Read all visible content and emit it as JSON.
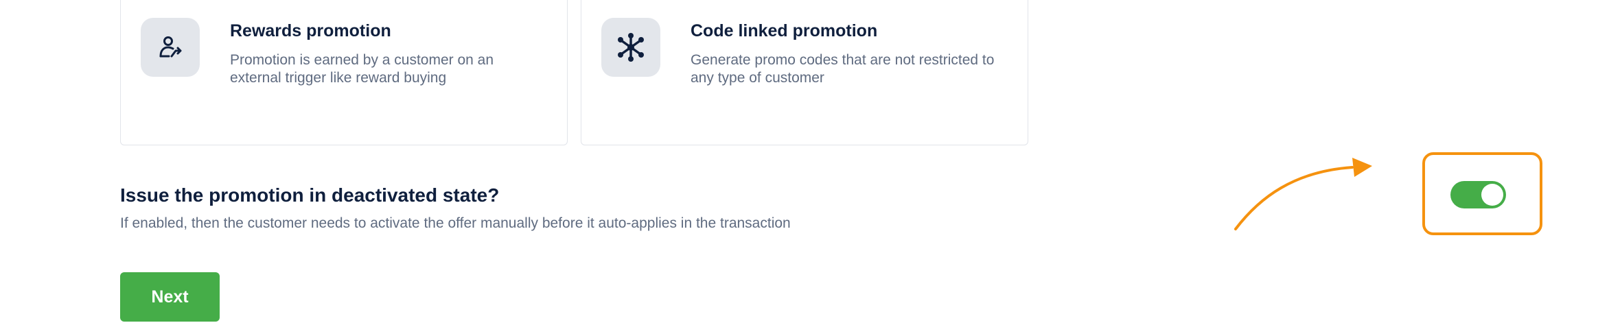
{
  "promotion_types": [
    {
      "title": "Rewards promotion",
      "description": "Promotion is earned by a customer on an external trigger like reward buying",
      "icon": "user-transfer-icon"
    },
    {
      "title": "Code linked promotion",
      "description": "Generate promo codes that are not restricted to any type of customer",
      "icon": "network-nodes-icon"
    }
  ],
  "deactivated_setting": {
    "title": "Issue the promotion in deactivated state?",
    "description": "If enabled, then the customer needs to activate the offer manually before it auto-applies in the transaction",
    "enabled": true
  },
  "next_label": "Next",
  "colors": {
    "primary_green": "#45ad48",
    "annotation_orange": "#f5920f",
    "title_text": "#0f1f3d",
    "body_text": "#5f6b80",
    "icon_tile": "#e3e6eb"
  }
}
